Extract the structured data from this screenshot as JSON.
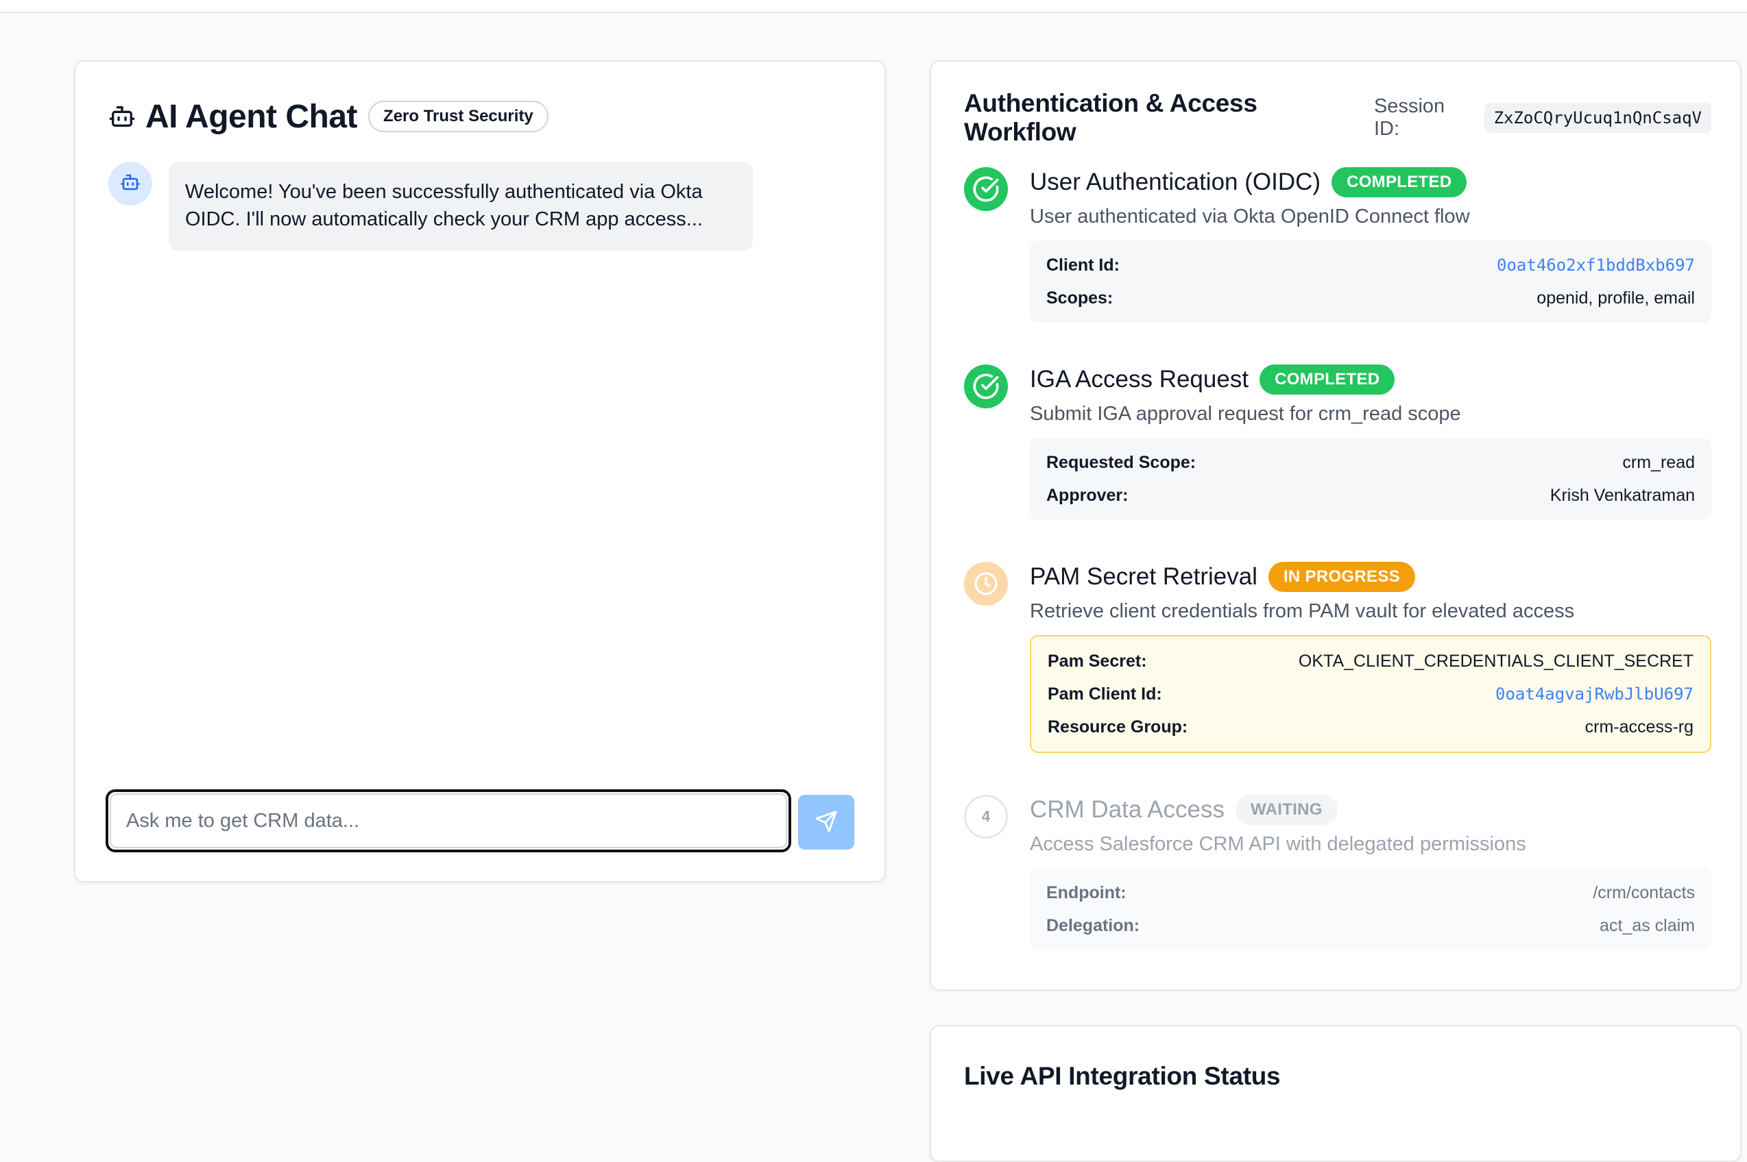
{
  "chat": {
    "title": "AI Agent Chat",
    "badge": "Zero Trust Security",
    "messages": [
      {
        "sender": "agent",
        "text": "Welcome! You've been successfully authenticated via Okta OIDC. I'll now automatically check your CRM app access..."
      }
    ],
    "input_placeholder": "Ask me to get CRM data...",
    "input_value": ""
  },
  "workflow": {
    "title": "Authentication & Access Workflow",
    "session_label": "Session ID:",
    "session_id": "ZxZoCQryUcuq1nQnCsaqV",
    "steps": [
      {
        "title": "User Authentication (OIDC)",
        "status": "COMPLETED",
        "description": "User authenticated via Okta OpenID Connect flow",
        "details": [
          {
            "key": "Client Id:",
            "value": "0oat46o2xf1bddBxb697"
          },
          {
            "key": "Scopes:",
            "value": "openid, profile, email"
          }
        ]
      },
      {
        "title": "IGA Access Request",
        "status": "COMPLETED",
        "description": "Submit IGA approval request for crm_read scope",
        "details": [
          {
            "key": "Requested Scope:",
            "value": "crm_read"
          },
          {
            "key": "Approver:",
            "value": "Krish Venkatraman"
          }
        ]
      },
      {
        "title": "PAM Secret Retrieval",
        "status": "IN PROGRESS",
        "description": "Retrieve client credentials from PAM vault for elevated access",
        "details": [
          {
            "key": "Pam Secret:",
            "value": "OKTA_CLIENT_CREDENTIALS_CLIENT_SECRET"
          },
          {
            "key": "Pam Client Id:",
            "value": "0oat4agvajRwbJlbU697"
          },
          {
            "key": "Resource Group:",
            "value": "crm-access-rg"
          }
        ]
      },
      {
        "number": "4",
        "title": "CRM Data Access",
        "status": "WAITING",
        "description": "Access Salesforce CRM API with delegated permissions",
        "details": [
          {
            "key": "Endpoint:",
            "value": "/crm/contacts"
          },
          {
            "key": "Delegation:",
            "value": "act_as claim"
          }
        ]
      }
    ]
  },
  "api_status": {
    "title": "Live API Integration Status"
  },
  "icons": {
    "chat_header": "robot-icon",
    "agent_avatar": "robot-icon",
    "send": "send-icon",
    "completed": "check-circle-icon",
    "in_progress": "clock-icon"
  },
  "colors": {
    "completed": "#22c55e",
    "in_progress": "#f59e0b",
    "send_button": "#93c5fd",
    "link_mono": "#3b82f6"
  }
}
